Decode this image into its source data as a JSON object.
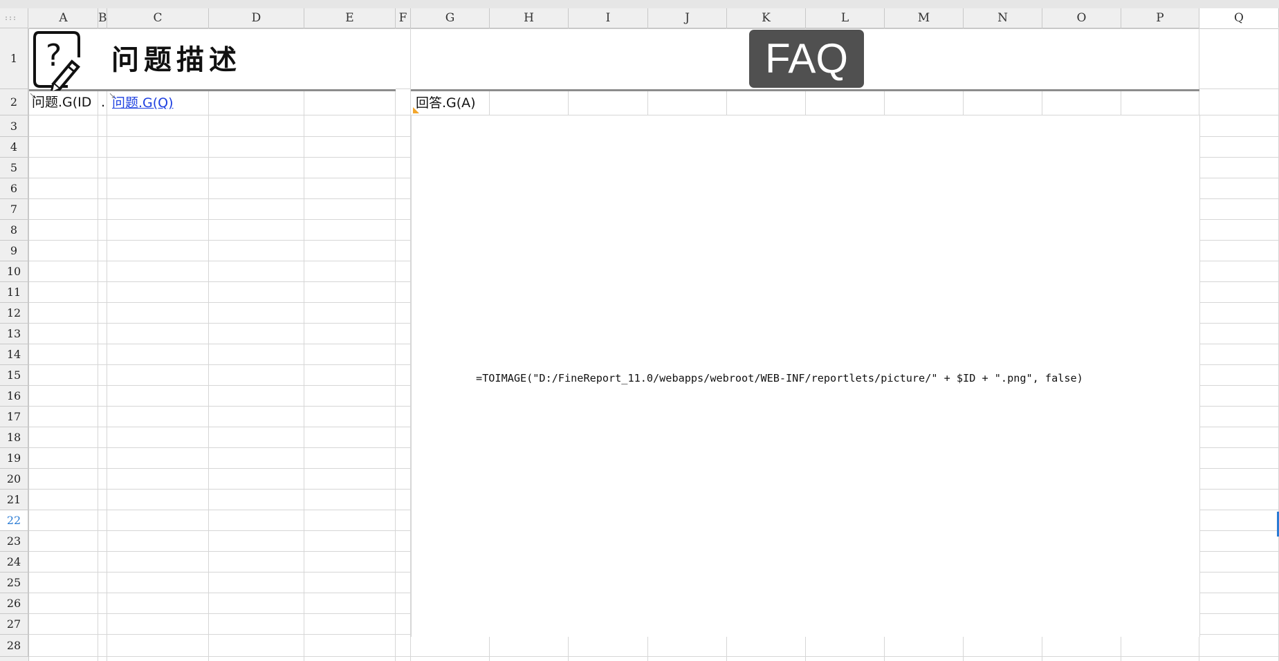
{
  "corner_glyph": ":::",
  "columns": [
    "A",
    "B",
    "C",
    "D",
    "E",
    "F",
    "G",
    "H",
    "I",
    "J",
    "K",
    "L",
    "M",
    "N",
    "O",
    "P",
    "Q"
  ],
  "rows": [
    "1",
    "2",
    "3",
    "4",
    "5",
    "6",
    "7",
    "8",
    "9",
    "10",
    "11",
    "12",
    "13",
    "14",
    "15",
    "16",
    "17",
    "18",
    "19",
    "20",
    "21",
    "22",
    "23",
    "24",
    "25",
    "26",
    "27",
    "28"
  ],
  "selected_column": "Q",
  "active_row": "22",
  "header": {
    "title": "问题描述",
    "faq_label": "FAQ",
    "icon": "question-edit-icon"
  },
  "cells": {
    "A2": "问题.G(ID",
    "A2_overflow": ".",
    "C2": "问题.G(Q)",
    "G2": "回答.G(A)",
    "formula": "=TOIMAGE(\"D:/FineReport_11.0/webapps/webroot/WEB-INF/reportlets/picture/\" + $ID + \".png\", false)"
  },
  "colors": {
    "header_bg": "#efefef",
    "grid_line": "#d6d6d6",
    "faq_bg": "#505050",
    "link": "#1d3fe0",
    "active_row_text": "#2a7bd4",
    "marker_triangle": "#f2a52b"
  }
}
